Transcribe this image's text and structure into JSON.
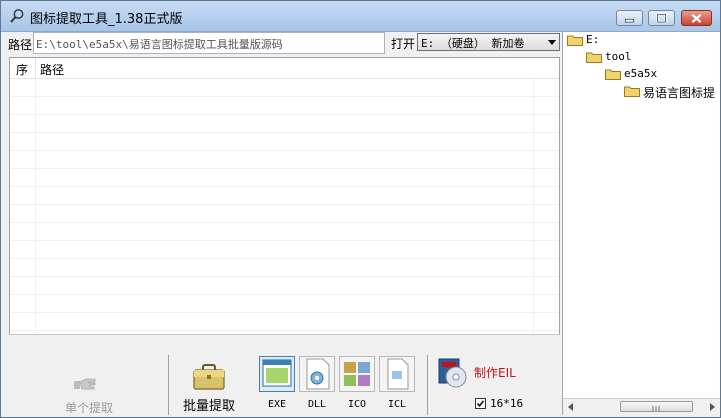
{
  "window": {
    "title": "图标提取工具_1.38正式版"
  },
  "path_bar": {
    "label": "路径",
    "value": "E:\\tool\\e5a5x\\易语言图标提取工具批量版源码",
    "open_label": "打开",
    "drive_selected": "E: （硬盘） 新加卷"
  },
  "list": {
    "columns": [
      "序",
      "路径"
    ]
  },
  "toolbar": {
    "single_extract": "单个提取",
    "batch_extract": "批量提取",
    "types": [
      "EXE",
      "DLL",
      "ICO",
      "ICL"
    ],
    "make_eil": "制作EIL",
    "size_option": "16*16",
    "size_checked": true
  },
  "tree": {
    "nodes": [
      {
        "label": "E:",
        "depth": 0
      },
      {
        "label": "tool",
        "depth": 1
      },
      {
        "label": "e5a5x",
        "depth": 2
      },
      {
        "label": "易语言图标提",
        "depth": 3
      }
    ]
  },
  "colors": {
    "accent_red": "#c0141a",
    "title_bar": "#b9d1ea"
  }
}
